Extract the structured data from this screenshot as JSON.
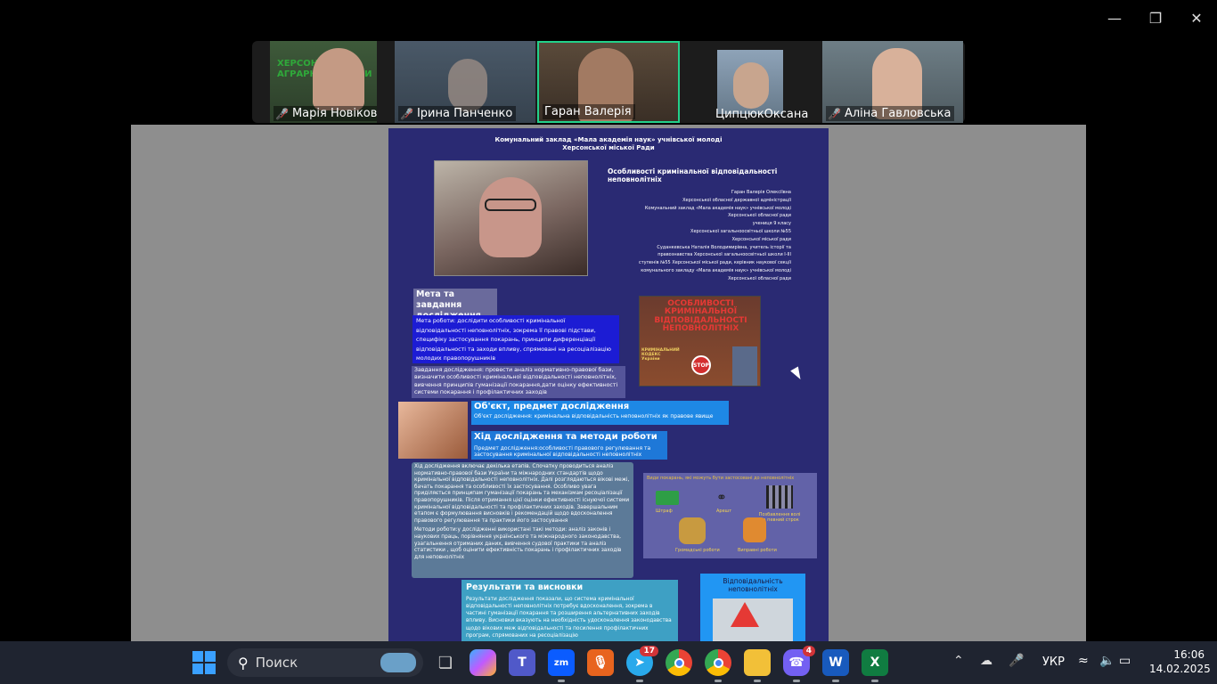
{
  "window": {
    "minimize_icon": "minimize-icon",
    "restore_icon": "restore-icon",
    "close_icon": "close-icon"
  },
  "participants": [
    {
      "name": "Марія Новікова",
      "muted": true,
      "bg_text": "ХЕРСОНСЬК АГРАРНО НІВЕРСИ"
    },
    {
      "name": "Ірина Панченко",
      "muted": true
    },
    {
      "name": "Гаран Валерія",
      "muted": false,
      "active": true
    },
    {
      "name": "ЦипцюкОксана",
      "muted": false
    },
    {
      "name": "Аліна Гавловська",
      "muted": true
    }
  ],
  "poster": {
    "header": "Комунальний заклад «Мала академія наук» учнівської молоді\nХерсонської міської Ради",
    "title": "Особливості кримінальної відповідальності неповнолітніх",
    "author_block": "Гаран Валерія Олексіївна\nХерсонської обласної державної адміністрації\nКомунальний заклад «Мала академія наук» учнівської молоді\nХерсонської обласної ради\nучениця 9 класу\nХерсонської загальноосвітньої школи №55\nХерсонської міської ради\nСуданкевська Наталія Володимирівна, учитель історії та\nправознавства Херсонської загальноосвітньої школи І-ІІІ\nступенів №55 Херсонської міської ради, керівник наукової секції\nкомунального закладу «Мала академія наук» учнівської молоді\nХерсонської обласної ради",
    "section_goal": "Мета та завдання\nдослідження",
    "goal_text": "Мета роботи: дослідити особливості кримінальної відповідальності неповнолітніх, зокрема її правові підстави, специфіку застосування покарань, принципи диференціації відповідальності та заходи впливу, спрямовані на ресоціалізацію молодих правопорушників",
    "tasks_text": "Завдання дослідження: провести аналіз нормативно-правової бази, визначити особливості кримінальної відповідальності неповнолітніх, вивчення принципів гуманізації покарання,дати оцінку ефективності системи покарання і профілактичних заходів",
    "book_title": "ОСОБЛИВОСТІ КРИМІНАЛЬНОЇ ВІДПОВІДАЛЬНОСТІ НЕПОВНОЛІТНІХ",
    "book_sub": "КРИМІНАЛЬНИЙ КОДЕКС України",
    "stop_sign": "STOP",
    "section_object": "Об'єкт, предмет дослідження",
    "object_text": "Об'єкт дослідження: кримінальна відповідальність неповнолітніх як правове явище",
    "section_method": "Хід дослідження та методи роботи",
    "subject_text": "Предмет дослідження:особливості правового регулювання та застосування кримінальної відповідальності неповнолітніх",
    "process_text": "Хід дослідження включає декілька етапів. Спочатку проводиться аналіз нормативно-правової бази України та міжнародних стандартів щодо кримінальної відповідальності неповнолітніх. Далі розглядаються вікові межі, бачать покарання та особливості їх застосування. Особливо увага приділяється принципам гуманізації покарань та механізмам ресоціалізації правопорушників. Після отримання цієї оцінки ефективності існуючої системи кримінальної відповідальності та профілактичних заходів. Завершальним етапом є формулювання висновків і рекомендацій щодо вдосконалення правового регулювання та практики його застосування",
    "methods_text": "Методи роботи:у дослідженні використані такі методи: аналіз законів і наукових праць, порівняння українського та міжнародного законодавства, узагальнення отриманих даних, вивчення судової практики та аналіз статистики , щоб оцінити ефективність покарань і профілактичних заходів для неповнолітніх",
    "punish_title": "Види покарань, які можуть бути застосовані до неповнолітніх",
    "punish_items": [
      "Штраф",
      "Арешт",
      "Позбавлення волі на певний строк",
      "Громадські роботи",
      "Виправні роботи"
    ],
    "section_results": "Результати та висновки",
    "results_text": "Результати дослідження показали, що система кримінальної відповідальності неповнолітніх потребує вдосконалення, зокрема в частині гуманізації покарання та розширення альтернативних заходів впливу. Висновки вказують на необхідність удосконалення законодавства щодо вікових меж відповідальності та посилення профілактичних програм, спрямованих на ресоціалізацію",
    "resp_title": "Відповідальність неповнолітніх"
  },
  "taskbar": {
    "search_placeholder": "Поиск",
    "telegram_badge": "17",
    "viber_badge": "4",
    "language": "УКР",
    "time": "16:06",
    "date": "14.02.2025",
    "icons": [
      "windows-start-icon",
      "search-icon",
      "task-view-icon",
      "copilot-icon",
      "teams-icon",
      "zoom-icon",
      "microphone-app-icon",
      "telegram-icon",
      "chrome-icon",
      "chrome-profile-icon",
      "file-explorer-icon",
      "viber-icon",
      "word-icon",
      "excel-icon"
    ]
  }
}
